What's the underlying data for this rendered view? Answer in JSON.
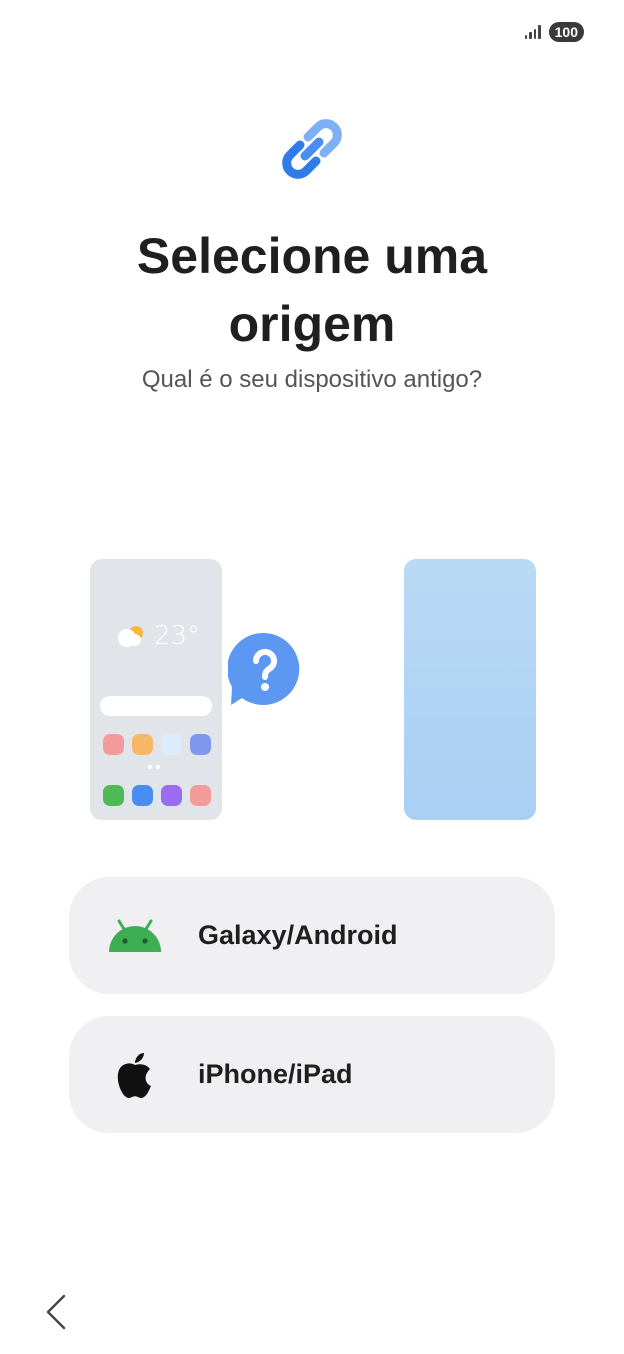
{
  "status_bar": {
    "battery": "100",
    "icons": [
      "signal-icon",
      "battery-icon"
    ]
  },
  "header": {
    "icon": "link-icon",
    "title_line1": "Selecione uma",
    "title_line2": "origem",
    "subtitle": "Qual é o seu dispositivo antigo?"
  },
  "illustration": {
    "temperature": "23°",
    "icons": [
      "weather-icon",
      "question-icon"
    ]
  },
  "options": [
    {
      "label": "Galaxy/Android",
      "icon": "android-icon"
    },
    {
      "label": "iPhone/iPad",
      "icon": "apple-icon"
    }
  ],
  "nav": {
    "icon": "back-chevron-icon"
  },
  "colors": {
    "accent": "#4a8df0",
    "android_green": "#3dae54",
    "option_bg": "#f0f0f2",
    "new_phone": "#b1d5f4"
  }
}
